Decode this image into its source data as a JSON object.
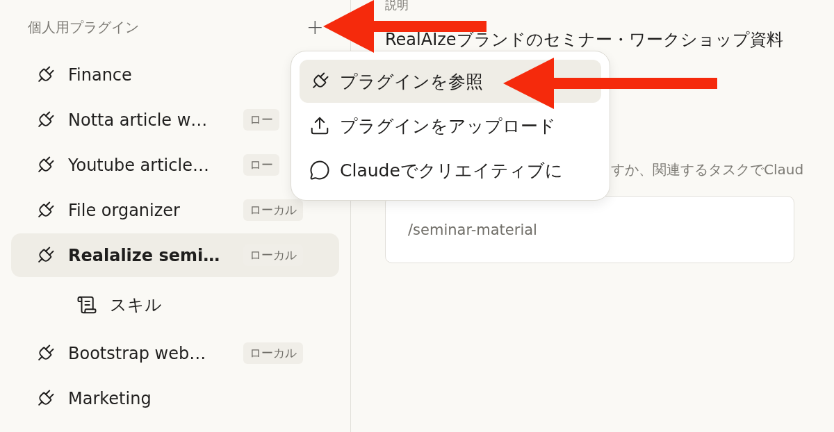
{
  "sidebar": {
    "title": "個人用プラグイン",
    "add_button": "+",
    "items": [
      {
        "label": "Finance",
        "selected": false
      },
      {
        "label": "Notta article w…",
        "badge": "ロー",
        "selected": false
      },
      {
        "label": "Youtube article…",
        "badge": "ロー",
        "selected": false
      },
      {
        "label": "File organizer",
        "badge": "ローカル",
        "selected": false
      },
      {
        "label": "Realalize semi…",
        "badge": "ローカル",
        "selected": true,
        "children": [
          {
            "label": "スキル"
          }
        ]
      },
      {
        "label": "Bootstrap web…",
        "badge": "ローカル",
        "selected": false
      },
      {
        "label": "Marketing",
        "selected": false
      }
    ]
  },
  "menu": {
    "items": [
      {
        "kind": "plug",
        "label": "プラグインを参照",
        "selected": true
      },
      {
        "kind": "upload",
        "label": "プラグインをアップロード",
        "selected": false
      },
      {
        "kind": "chat",
        "label": "Claudeでクリエイティブに",
        "selected": false
      }
    ]
  },
  "main": {
    "description_label": "説明",
    "description": "RealAIzeブランドのセミナー・ワークショップ資料",
    "hint": "すか、関連するタスクでClaud",
    "command_field": {
      "value": "/seminar-material"
    }
  }
}
